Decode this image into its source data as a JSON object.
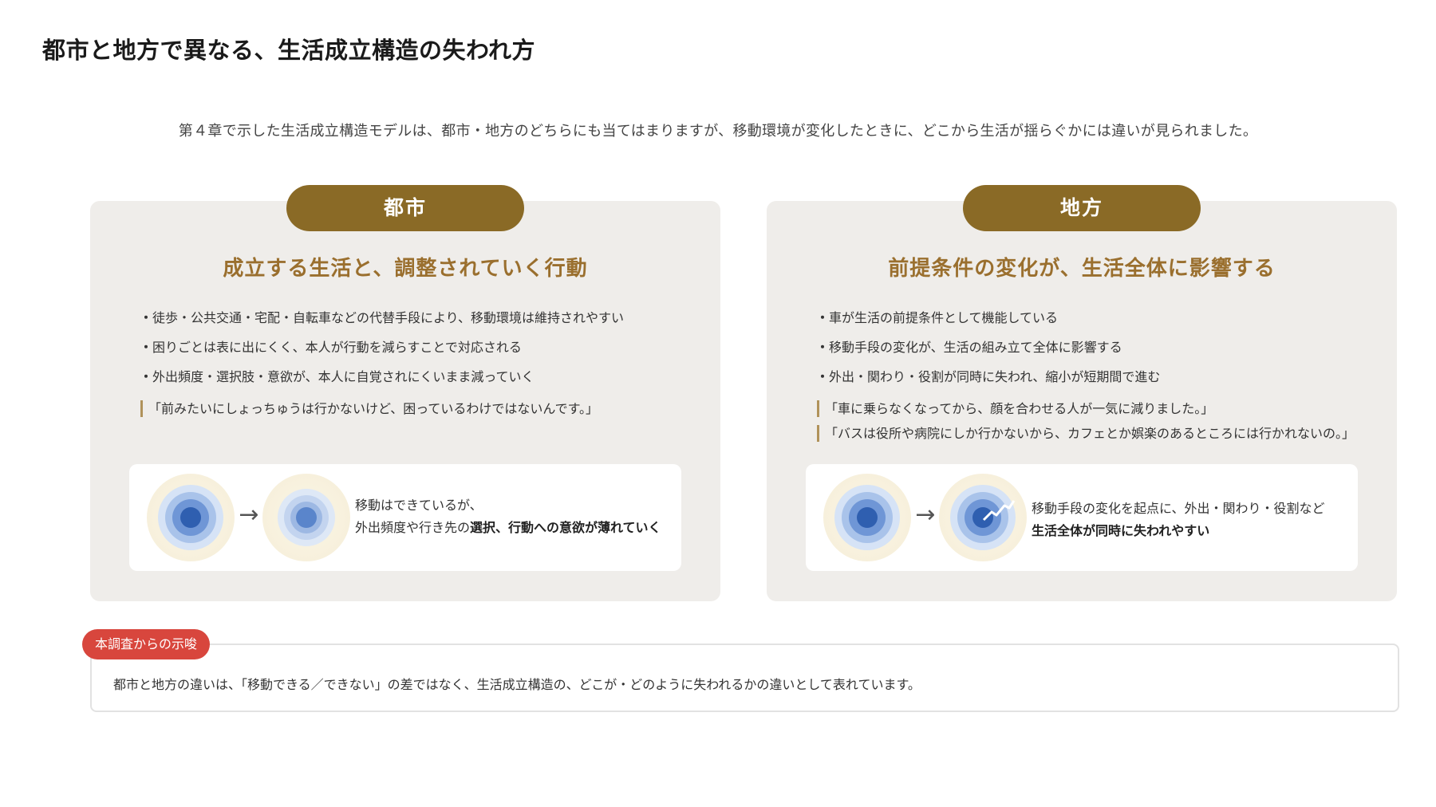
{
  "page": {
    "title": "都市と地方で異なる、生活成立構造の失われ方",
    "intro": "第４章で示した生活成立構造モデルは、都市・地方のどちらにも当てはまりますが、移動環境が変化したときに、どこから生活が揺らぐかには違いが見られました。"
  },
  "colors": {
    "pill": "#8a6a26",
    "headline": "#9a6f2e",
    "panel_bg": "#efedea",
    "insight_tag": "#d8463d",
    "ring_core": "#2f5fb0"
  },
  "panels": [
    {
      "label": "都市",
      "headline": "成立する生活と、調整されていく行動",
      "bullets": [
        "徒歩・公共交通・宅配・自転車などの代替手段により、移動環境は維持されやすい",
        "困りごとは表に出にくく、本人が行動を減らすことで対応される",
        "外出頻度・選択肢・意欲が、本人に自覚されにくいまま減っていく"
      ],
      "quotes": [
        "「前みたいにしょっちゅうは行かないけど、困っているわけではないんです。」"
      ],
      "illustration": {
        "icons": [
          "concentric-circles-icon",
          "arrow-right-icon",
          "faded-concentric-circles-icon"
        ],
        "arrow": "→",
        "text_line1": "移動はできているが、",
        "text_line2_normal": "外出頻度や行き先の",
        "text_line2_bold": "選択、行動への意欲が薄れていく"
      }
    },
    {
      "label": "地方",
      "headline": "前提条件の変化が、生活全体に影響する",
      "bullets": [
        "車が生活の前提条件として機能している",
        "移動手段の変化が、生活の組み立て全体に影響する",
        "外出・関わり・役割が同時に失われ、縮小が短期間で進む"
      ],
      "quotes": [
        "「車に乗らなくなってから、顔を合わせる人が一気に減りました。」",
        "「バスは役所や病院にしか行かないから、カフェとか娯楽のあるところには行かれないの。」"
      ],
      "illustration": {
        "icons": [
          "concentric-circles-icon",
          "arrow-right-icon",
          "cracked-concentric-circles-icon"
        ],
        "arrow": "→",
        "text_line1": "移動手段の変化を起点に、外出・関わり・役割など",
        "text_line2_normal": "",
        "text_line2_bold": "生活全体が同時に失われやすい"
      }
    }
  ],
  "insight": {
    "tag": "本調査からの示唆",
    "text": "都市と地方の違いは、「移動できる／できない」の差ではなく、生活成立構造の、どこが・どのように失われるかの違いとして表れています。"
  }
}
